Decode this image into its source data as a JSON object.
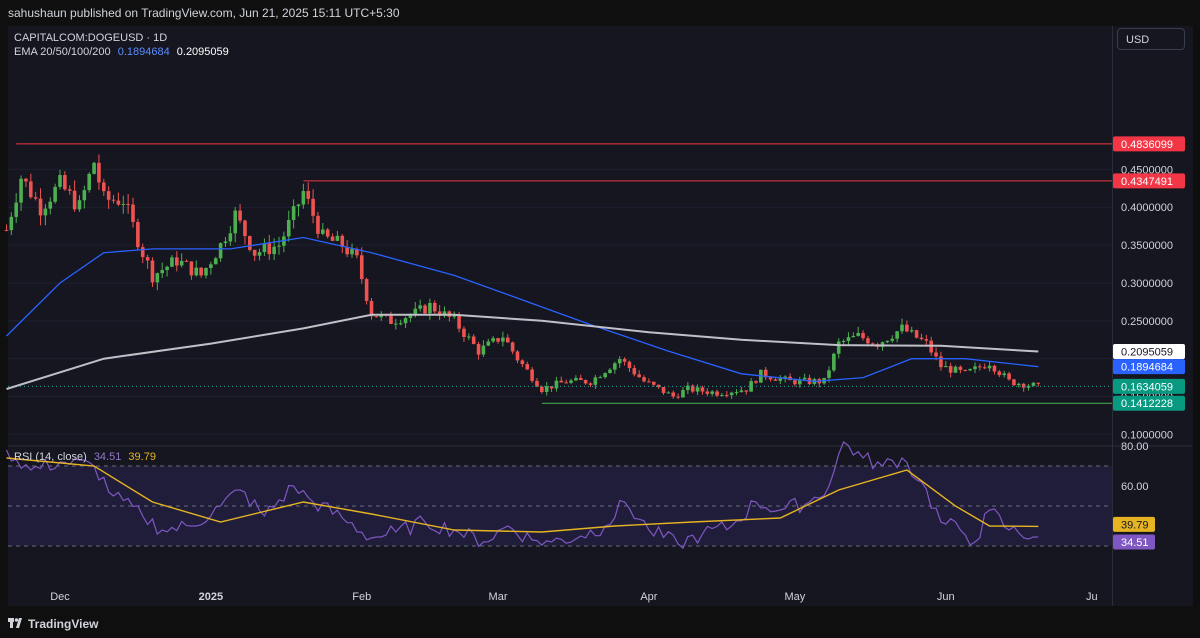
{
  "header": {
    "published": "sahushaun published on TradingView.com, Jun 21, 2025 15:11 UTC+5:30"
  },
  "legend": {
    "symbol": "CAPITALCOM:DOGEUSD · 1D",
    "ema_label": "EMA 20/50/100/200",
    "ema_val_1": "0.1894684",
    "ema_val_2": "0.2095059",
    "rsi_label": "RSI (14, close)",
    "rsi_val": "34.51",
    "rsi_ma_val": "39.79"
  },
  "currency": "USD",
  "footer": {
    "brand": "TradingView"
  },
  "colors": {
    "up": "#26a69a",
    "up_bright": "#4caf50",
    "down": "#ef5350",
    "ema_blue": "#2962ff",
    "ema_grey": "#c0c0c8",
    "rsi": "#7e57c2",
    "rsi_ma": "#e6b422",
    "resistance": "#f23645",
    "support": "#4caf50",
    "bg": "#151620"
  },
  "chart_data": [
    {
      "type": "candlestick",
      "title": "CAPITALCOM:DOGEUSD · 1D",
      "x_ticks": [
        "Dec",
        "2025",
        "Feb",
        "Mar",
        "Apr",
        "May",
        "Jun",
        "Ju"
      ],
      "y_ticks": [
        "0.4500000",
        "0.4000000",
        "0.3500000",
        "0.3000000",
        "0.2500000",
        "0.2000000",
        "0.1500000",
        "0.1000000"
      ],
      "ylim": [
        0.09,
        0.5
      ],
      "price_labels": [
        {
          "label": "0.4836099",
          "value": 0.4836099,
          "kind": "resistance"
        },
        {
          "label": "0.4347491",
          "value": 0.4347491,
          "kind": "resistance"
        },
        {
          "label": "0.2095059",
          "value": 0.2095059,
          "kind": "ema200"
        },
        {
          "label": "0.1894684",
          "value": 0.1894684,
          "kind": "ema50"
        },
        {
          "label": "0.1634059",
          "value": 0.1634059,
          "kind": "last"
        },
        {
          "label": "0.1412228",
          "value": 0.1412228,
          "kind": "support"
        }
      ],
      "horizontal_lines": [
        {
          "value": 0.4836099,
          "x_start": "Nov 22",
          "kind": "resistance"
        },
        {
          "value": 0.4347491,
          "x_start": "Jan 20",
          "kind": "resistance"
        },
        {
          "value": 0.1412228,
          "x_start": "Mar 10",
          "kind": "support"
        }
      ],
      "price_path": [
        {
          "date": "Nov 20",
          "v": 0.37
        },
        {
          "date": "Nov 23",
          "v": 0.44
        },
        {
          "date": "Nov 27",
          "v": 0.4
        },
        {
          "date": "Dec 1",
          "v": 0.43
        },
        {
          "date": "Dec 5",
          "v": 0.4
        },
        {
          "date": "Dec 8",
          "v": 0.46
        },
        {
          "date": "Dec 10",
          "v": 0.41
        },
        {
          "date": "Dec 14",
          "v": 0.41
        },
        {
          "date": "Dec 18",
          "v": 0.34
        },
        {
          "date": "Dec 20",
          "v": 0.31
        },
        {
          "date": "Dec 25",
          "v": 0.33
        },
        {
          "date": "Dec 30",
          "v": 0.31
        },
        {
          "date": "Jan 3",
          "v": 0.35
        },
        {
          "date": "Jan 6",
          "v": 0.39
        },
        {
          "date": "Jan 10",
          "v": 0.34
        },
        {
          "date": "Jan 15",
          "v": 0.35
        },
        {
          "date": "Jan 18",
          "v": 0.39
        },
        {
          "date": "Jan 20",
          "v": 0.42
        },
        {
          "date": "Jan 24",
          "v": 0.36
        },
        {
          "date": "Jan 28",
          "v": 0.35
        },
        {
          "date": "Jan 31",
          "v": 0.33
        },
        {
          "date": "Feb 3",
          "v": 0.26
        },
        {
          "date": "Feb 7",
          "v": 0.25
        },
        {
          "date": "Feb 12",
          "v": 0.26
        },
        {
          "date": "Feb 15",
          "v": 0.27
        },
        {
          "date": "Feb 20",
          "v": 0.25
        },
        {
          "date": "Feb 25",
          "v": 0.21
        },
        {
          "date": "Mar 2",
          "v": 0.23
        },
        {
          "date": "Mar 5",
          "v": 0.2
        },
        {
          "date": "Mar 10",
          "v": 0.16
        },
        {
          "date": "Mar 15",
          "v": 0.17
        },
        {
          "date": "Mar 20",
          "v": 0.17
        },
        {
          "date": "Mar 26",
          "v": 0.2
        },
        {
          "date": "Mar 31",
          "v": 0.17
        },
        {
          "date": "Apr 6",
          "v": 0.15
        },
        {
          "date": "Apr 9",
          "v": 0.16
        },
        {
          "date": "Apr 15",
          "v": 0.155
        },
        {
          "date": "Apr 21",
          "v": 0.16
        },
        {
          "date": "Apr 24",
          "v": 0.18
        },
        {
          "date": "Apr 30",
          "v": 0.17
        },
        {
          "date": "May 7",
          "v": 0.17
        },
        {
          "date": "May 10",
          "v": 0.22
        },
        {
          "date": "May 14",
          "v": 0.23
        },
        {
          "date": "May 18",
          "v": 0.22
        },
        {
          "date": "May 23",
          "v": 0.24
        },
        {
          "date": "May 28",
          "v": 0.22
        },
        {
          "date": "May 31",
          "v": 0.19
        },
        {
          "date": "Jun 5",
          "v": 0.18
        },
        {
          "date": "Jun 10",
          "v": 0.195
        },
        {
          "date": "Jun 14",
          "v": 0.17
        },
        {
          "date": "Jun 20",
          "v": 0.1634
        }
      ],
      "series": [
        {
          "name": "EMA 50",
          "values": [
            {
              "date": "Nov 20",
              "v": 0.23
            },
            {
              "date": "Dec 1",
              "v": 0.3
            },
            {
              "date": "Dec 10",
              "v": 0.34
            },
            {
              "date": "Dec 20",
              "v": 0.345
            },
            {
              "date": "Jan 5",
              "v": 0.345
            },
            {
              "date": "Jan 20",
              "v": 0.36
            },
            {
              "date": "Feb 3",
              "v": 0.34
            },
            {
              "date": "Feb 20",
              "v": 0.31
            },
            {
              "date": "Mar 5",
              "v": 0.28
            },
            {
              "date": "Mar 20",
              "v": 0.245
            },
            {
              "date": "Apr 5",
              "v": 0.21
            },
            {
              "date": "Apr 20",
              "v": 0.18
            },
            {
              "date": "May 5",
              "v": 0.17
            },
            {
              "date": "May 15",
              "v": 0.175
            },
            {
              "date": "May 25",
              "v": 0.2
            },
            {
              "date": "Jun 5",
              "v": 0.2
            },
            {
              "date": "Jun 20",
              "v": 0.1894684
            }
          ]
        },
        {
          "name": "EMA 200",
          "values": [
            {
              "date": "Nov 20",
              "v": 0.16
            },
            {
              "date": "Dec 10",
              "v": 0.2
            },
            {
              "date": "Jan 1",
              "v": 0.22
            },
            {
              "date": "Jan 20",
              "v": 0.24
            },
            {
              "date": "Feb 3",
              "v": 0.258
            },
            {
              "date": "Feb 20",
              "v": 0.258
            },
            {
              "date": "Mar 10",
              "v": 0.25
            },
            {
              "date": "Apr 1",
              "v": 0.235
            },
            {
              "date": "Apr 20",
              "v": 0.225
            },
            {
              "date": "May 10",
              "v": 0.218
            },
            {
              "date": "May 31",
              "v": 0.217
            },
            {
              "date": "Jun 20",
              "v": 0.2095059
            }
          ]
        }
      ]
    },
    {
      "type": "line",
      "title": "RSI (14, close)",
      "y_ticks": [
        "80.00",
        "60.00"
      ],
      "ylim": [
        20,
        90
      ],
      "bands": {
        "upper": 70,
        "middle": 50,
        "lower": 30
      },
      "value_labels": [
        "39.79",
        "34.51"
      ],
      "series": [
        {
          "name": "RSI",
          "values": [
            {
              "date": "Nov 20",
              "v": 78
            },
            {
              "date": "Nov 25",
              "v": 68
            },
            {
              "date": "Dec 1",
              "v": 72
            },
            {
              "date": "Dec 8",
              "v": 70
            },
            {
              "date": "Dec 12",
              "v": 55
            },
            {
              "date": "Dec 18",
              "v": 45
            },
            {
              "date": "Dec 22",
              "v": 38
            },
            {
              "date": "Dec 28",
              "v": 40
            },
            {
              "date": "Jan 3",
              "v": 50
            },
            {
              "date": "Jan 7",
              "v": 58
            },
            {
              "date": "Jan 12",
              "v": 45
            },
            {
              "date": "Jan 18",
              "v": 60
            },
            {
              "date": "Jan 22",
              "v": 52
            },
            {
              "date": "Jan 28",
              "v": 44
            },
            {
              "date": "Feb 3",
              "v": 34
            },
            {
              "date": "Feb 8",
              "v": 37
            },
            {
              "date": "Feb 14",
              "v": 42
            },
            {
              "date": "Feb 20",
              "v": 38
            },
            {
              "date": "Feb 26",
              "v": 32
            },
            {
              "date": "Mar 3",
              "v": 40
            },
            {
              "date": "Mar 8",
              "v": 33
            },
            {
              "date": "Mar 12",
              "v": 32
            },
            {
              "date": "Mar 18",
              "v": 35
            },
            {
              "date": "Mar 23",
              "v": 40
            },
            {
              "date": "Mar 27",
              "v": 52
            },
            {
              "date": "Apr 1",
              "v": 38
            },
            {
              "date": "Apr 7",
              "v": 31
            },
            {
              "date": "Apr 12",
              "v": 36
            },
            {
              "date": "Apr 18",
              "v": 40
            },
            {
              "date": "Apr 23",
              "v": 52
            },
            {
              "date": "Apr 28",
              "v": 48
            },
            {
              "date": "May 4",
              "v": 52
            },
            {
              "date": "May 8",
              "v": 60
            },
            {
              "date": "May 11",
              "v": 82
            },
            {
              "date": "May 15",
              "v": 74
            },
            {
              "date": "May 19",
              "v": 70
            },
            {
              "date": "May 23",
              "v": 74
            },
            {
              "date": "May 27",
              "v": 62
            },
            {
              "date": "May 31",
              "v": 42
            },
            {
              "date": "Jun 4",
              "v": 38
            },
            {
              "date": "Jun 7",
              "v": 32
            },
            {
              "date": "Jun 10",
              "v": 48
            },
            {
              "date": "Jun 14",
              "v": 38
            },
            {
              "date": "Jun 20",
              "v": 34.51
            }
          ]
        },
        {
          "name": "RSI MA",
          "values": [
            {
              "date": "Nov 20",
              "v": 74
            },
            {
              "date": "Dec 8",
              "v": 70
            },
            {
              "date": "Dec 20",
              "v": 52
            },
            {
              "date": "Jan 3",
              "v": 42
            },
            {
              "date": "Jan 20",
              "v": 52
            },
            {
              "date": "Feb 3",
              "v": 46
            },
            {
              "date": "Feb 20",
              "v": 38
            },
            {
              "date": "Mar 10",
              "v": 37
            },
            {
              "date": "Mar 25",
              "v": 40
            },
            {
              "date": "Apr 10",
              "v": 42
            },
            {
              "date": "Apr 28",
              "v": 44
            },
            {
              "date": "May 10",
              "v": 58
            },
            {
              "date": "May 24",
              "v": 68
            },
            {
              "date": "Jun 3",
              "v": 50
            },
            {
              "date": "Jun 10",
              "v": 40
            },
            {
              "date": "Jun 20",
              "v": 39.79
            }
          ]
        }
      ]
    }
  ]
}
